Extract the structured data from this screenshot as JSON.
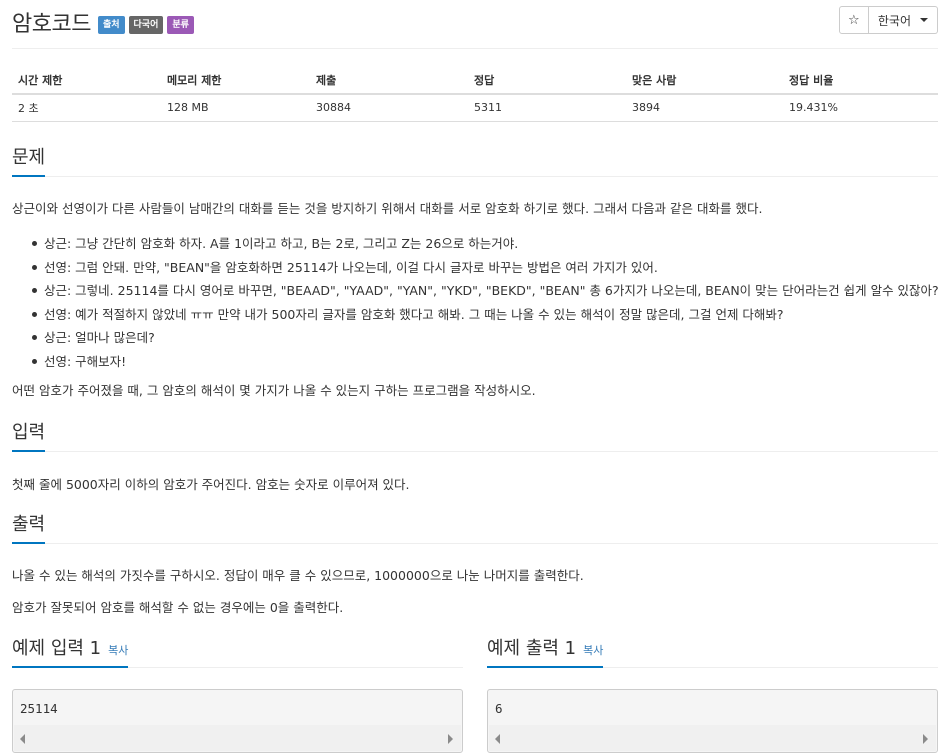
{
  "problem": {
    "title": "암호코드",
    "badges": [
      {
        "label": "출처",
        "color": "#428bca"
      },
      {
        "label": "다국어",
        "color": "#666666"
      },
      {
        "label": "분류",
        "color": "#9b59b6"
      }
    ]
  },
  "controls": {
    "star": "☆",
    "language": "한국어"
  },
  "stats": {
    "headers": [
      "시간 제한",
      "메모리 제한",
      "제출",
      "정답",
      "맞은 사람",
      "정답 비율"
    ],
    "values": [
      "2 초",
      "128 MB",
      "30884",
      "5311",
      "3894",
      "19.431%"
    ]
  },
  "sections": {
    "problem_heading": "문제",
    "input_heading": "입력",
    "output_heading": "출력"
  },
  "description": {
    "intro": "상근이와 선영이가 다른 사람들이 남매간의 대화를 듣는 것을 방지하기 위해서 대화를 서로 암호화 하기로 했다. 그래서 다음과 같은 대화를 했다.",
    "dialog": [
      "상근: 그냥 간단히 암호화 하자. A를 1이라고 하고, B는 2로, 그리고 Z는 26으로 하는거야.",
      "선영: 그럼 안돼. 만약, \"BEAN\"을 암호화하면 25114가 나오는데, 이걸 다시 글자로 바꾸는 방법은 여러 가지가 있어.",
      "상근: 그렇네. 25114를 다시 영어로 바꾸면, \"BEAAD\", \"YAAD\", \"YAN\", \"YKD\", \"BEKD\", \"BEAN\" 총 6가지가 나오는데, BEAN이 맞는 단어라는건 쉽게 알수 있잖아?",
      "선영: 예가 적절하지 않았네 ㅠㅠ 만약 내가 500자리 글자를 암호화 했다고 해봐. 그 때는 나올 수 있는 해석이 정말 많은데, 그걸 언제 다해봐?",
      "상근: 얼마나 많은데?",
      "선영: 구해보자!"
    ],
    "task": "어떤 암호가 주어졌을 때, 그 암호의 해석이 몇 가지가 나올 수 있는지 구하는 프로그램을 작성하시오."
  },
  "input": {
    "text": "첫째 줄에 5000자리 이하의 암호가 주어진다. 암호는 숫자로 이루어져 있다."
  },
  "output": {
    "line1": "나올 수 있는 해석의 가짓수를 구하시오. 정답이 매우 클 수 있으므로, 1000000으로 나눈 나머지를 출력한다.",
    "line2": "암호가 잘못되어 암호를 해석할 수 없는 경우에는 0을 출력한다."
  },
  "samples": {
    "input_title": "예제 입력 1",
    "output_title": "예제 출력 1",
    "copy_label": "복사",
    "input_value": "25114",
    "output_value": "6"
  }
}
